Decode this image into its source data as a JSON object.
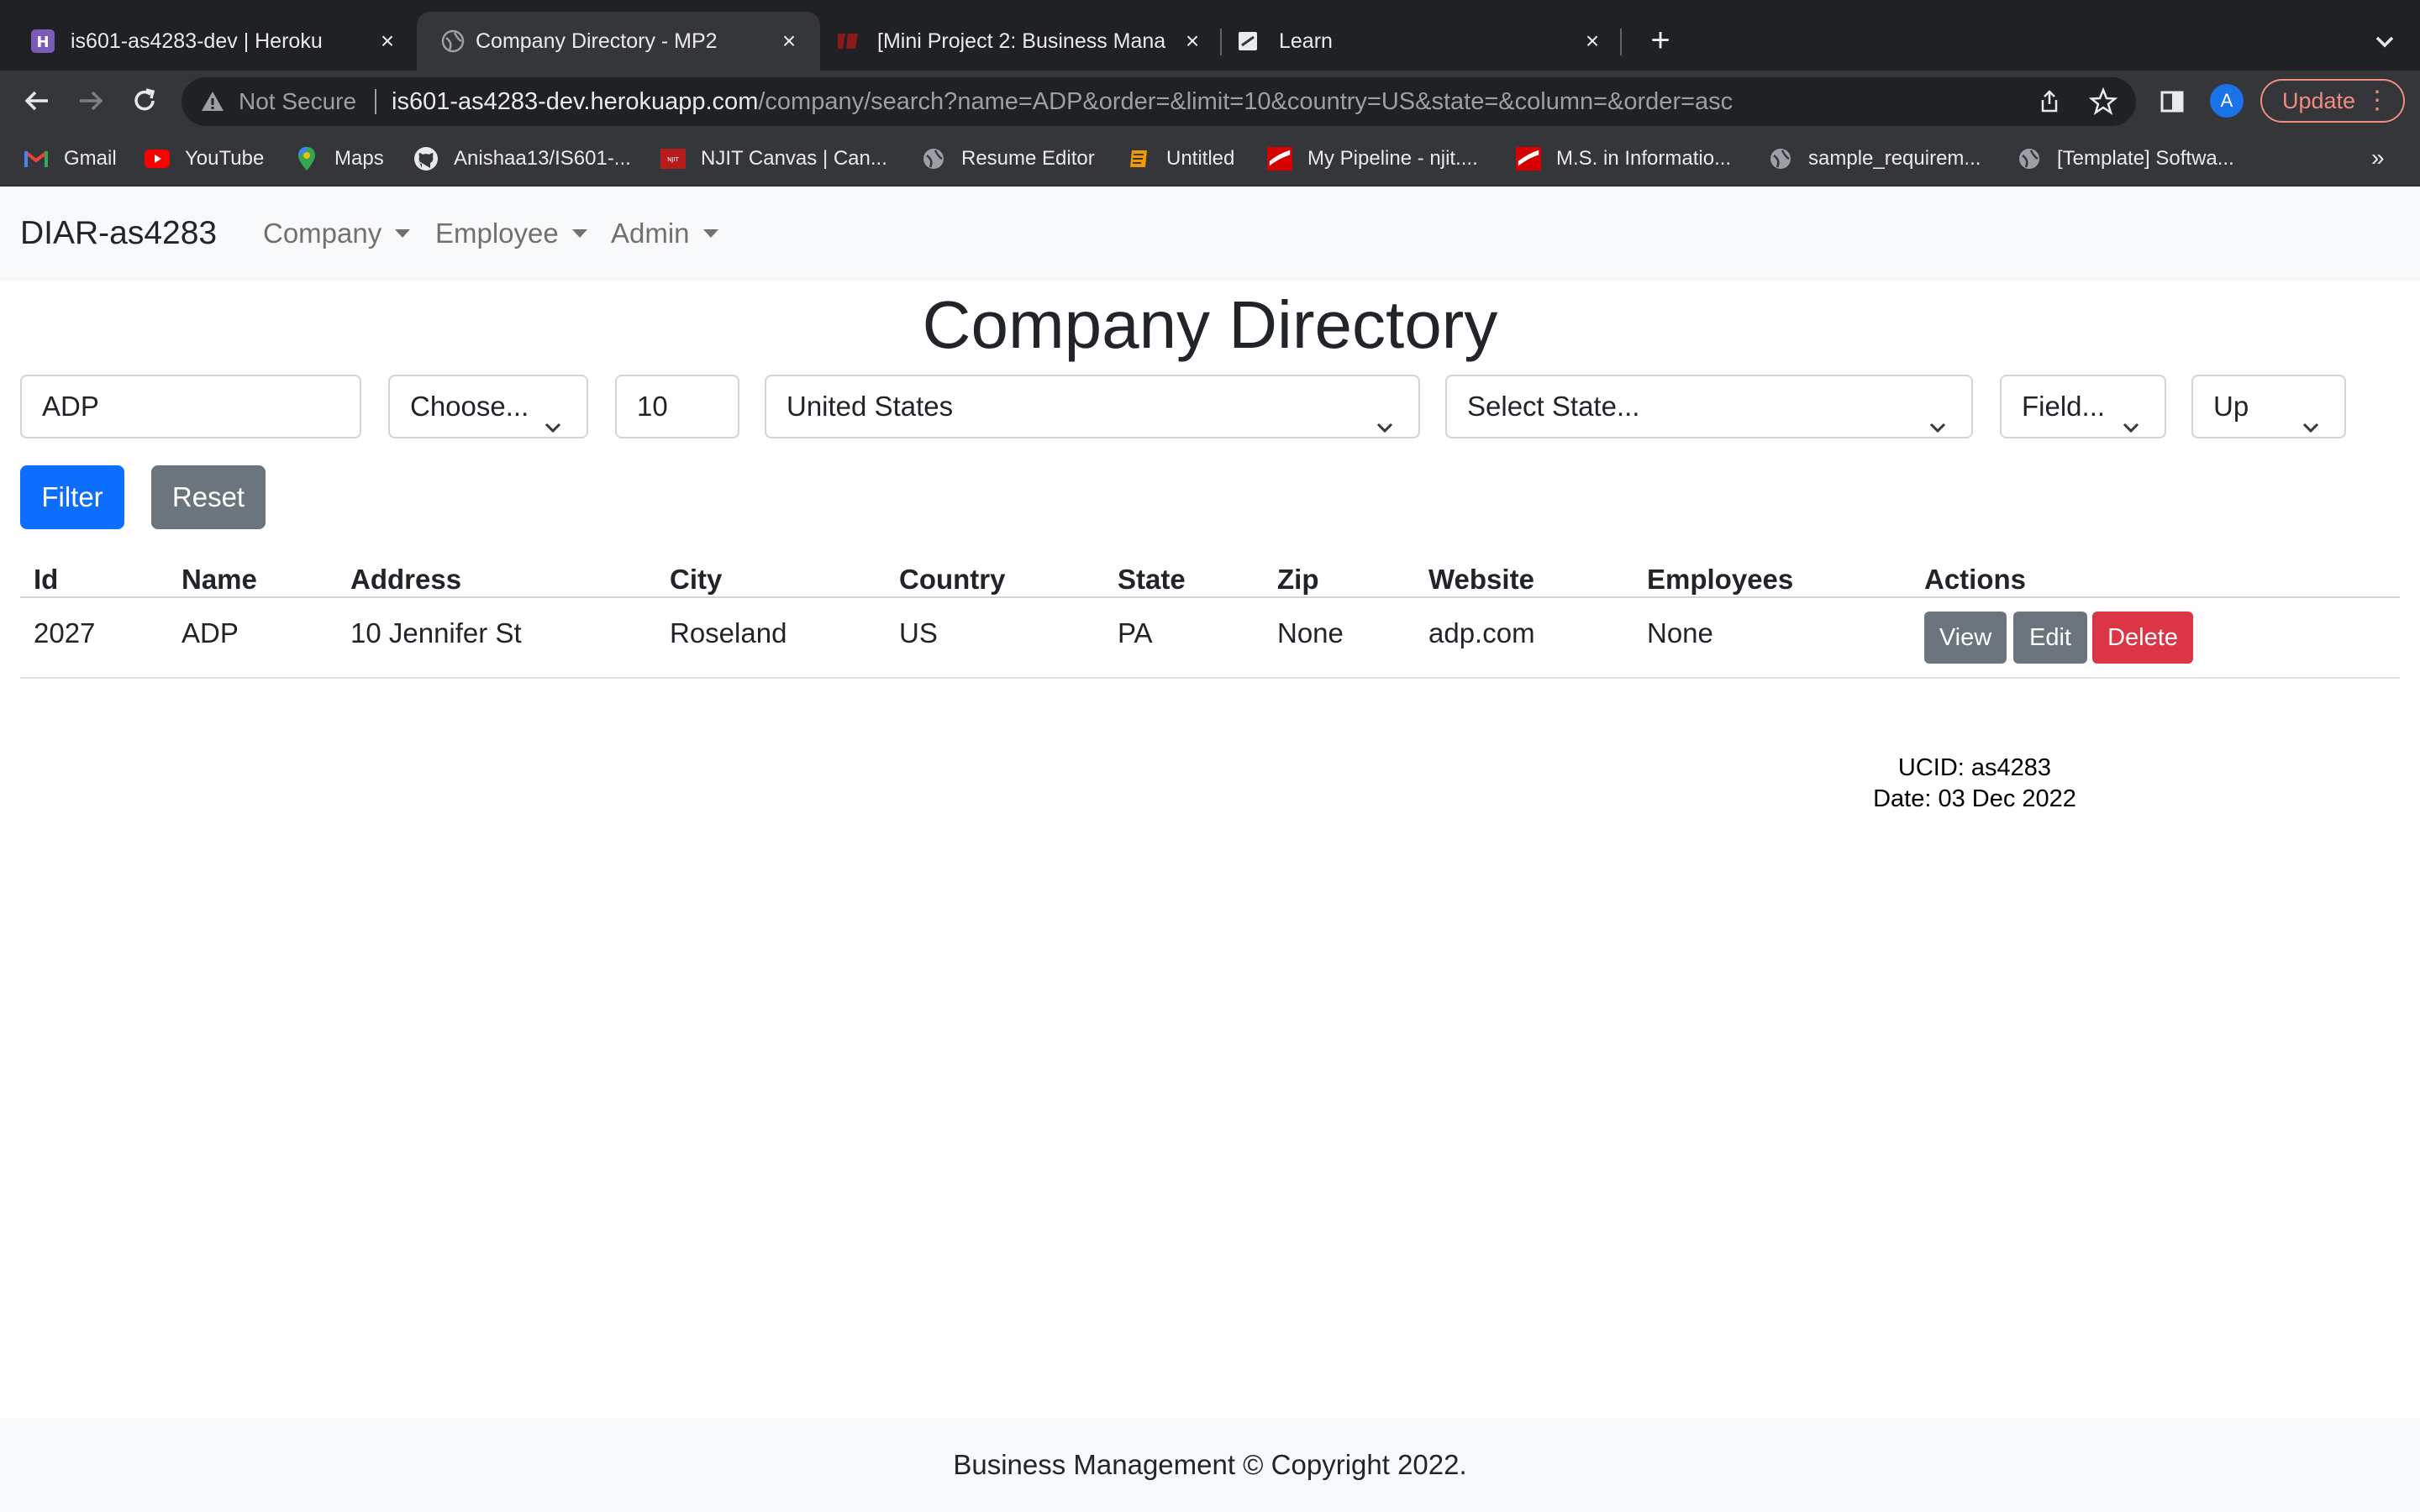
{
  "browser": {
    "tabs": [
      {
        "title": "is601-as4283-dev | Heroku",
        "icon": "heroku-icon"
      },
      {
        "title": "Company Directory - MP2",
        "icon": "globe-icon"
      },
      {
        "title": "[Mini Project 2: Business Mana",
        "icon": "njit-icon"
      },
      {
        "title": "Learn",
        "icon": "learn-icon"
      }
    ],
    "omnibox": {
      "security_label": "Not Secure",
      "url_host": "is601-as4283-dev.herokuapp.com",
      "url_path": "/company/search?name=ADP&order=&limit=10&country=US&state=&column=&order=asc"
    },
    "profile_initial": "A",
    "update_label": "Update",
    "bookmarks": [
      {
        "label": "Gmail",
        "icon": "gmail-icon"
      },
      {
        "label": "YouTube",
        "icon": "youtube-icon"
      },
      {
        "label": "Maps",
        "icon": "maps-icon"
      },
      {
        "label": "Anishaa13/IS601-...",
        "icon": "github-icon"
      },
      {
        "label": "NJIT Canvas | Can...",
        "icon": "njit-icon"
      },
      {
        "label": "Resume Editor",
        "icon": "globe-icon"
      },
      {
        "label": "Untitled",
        "icon": "doc-icon"
      },
      {
        "label": "My Pipeline - njit....",
        "icon": "pipeline-icon"
      },
      {
        "label": "M.S. in Informatio...",
        "icon": "pipeline-icon"
      },
      {
        "label": "sample_requirem...",
        "icon": "globe-icon"
      },
      {
        "label": "[Template] Softwa...",
        "icon": "globe-icon"
      }
    ],
    "bookmarks_more": "»"
  },
  "navbar": {
    "brand": "DIAR-as4283",
    "links": [
      "Company",
      "Employee",
      "Admin"
    ]
  },
  "page_title": "Company Directory",
  "filters": {
    "name": "ADP",
    "order": "Choose...",
    "limit": "10",
    "country": "United States",
    "state": "Select State...",
    "column": "Field...",
    "direction": "Up"
  },
  "buttons": {
    "filter": "Filter",
    "reset": "Reset"
  },
  "table": {
    "headers": [
      "Id",
      "Name",
      "Address",
      "City",
      "Country",
      "State",
      "Zip",
      "Website",
      "Employees",
      "Actions"
    ],
    "rows": [
      {
        "cells": [
          "2027",
          "ADP",
          "10 Jennifer St",
          "Roseland",
          "US",
          "PA",
          "None",
          "adp.com",
          "None"
        ],
        "actions": [
          "View",
          "Edit",
          "Delete"
        ]
      }
    ]
  },
  "ucid": "UCID: as4283",
  "date": "Date: 03 Dec 2022",
  "footer": "Business Management © Copyright 2022.",
  "colors": {
    "primary": "#0d6efd",
    "secondary": "#6c757d",
    "danger": "#dc3545",
    "navbar_bg": "#f8f9fa",
    "chrome_dark": "#202124",
    "chrome_toolbar": "#35363a"
  }
}
